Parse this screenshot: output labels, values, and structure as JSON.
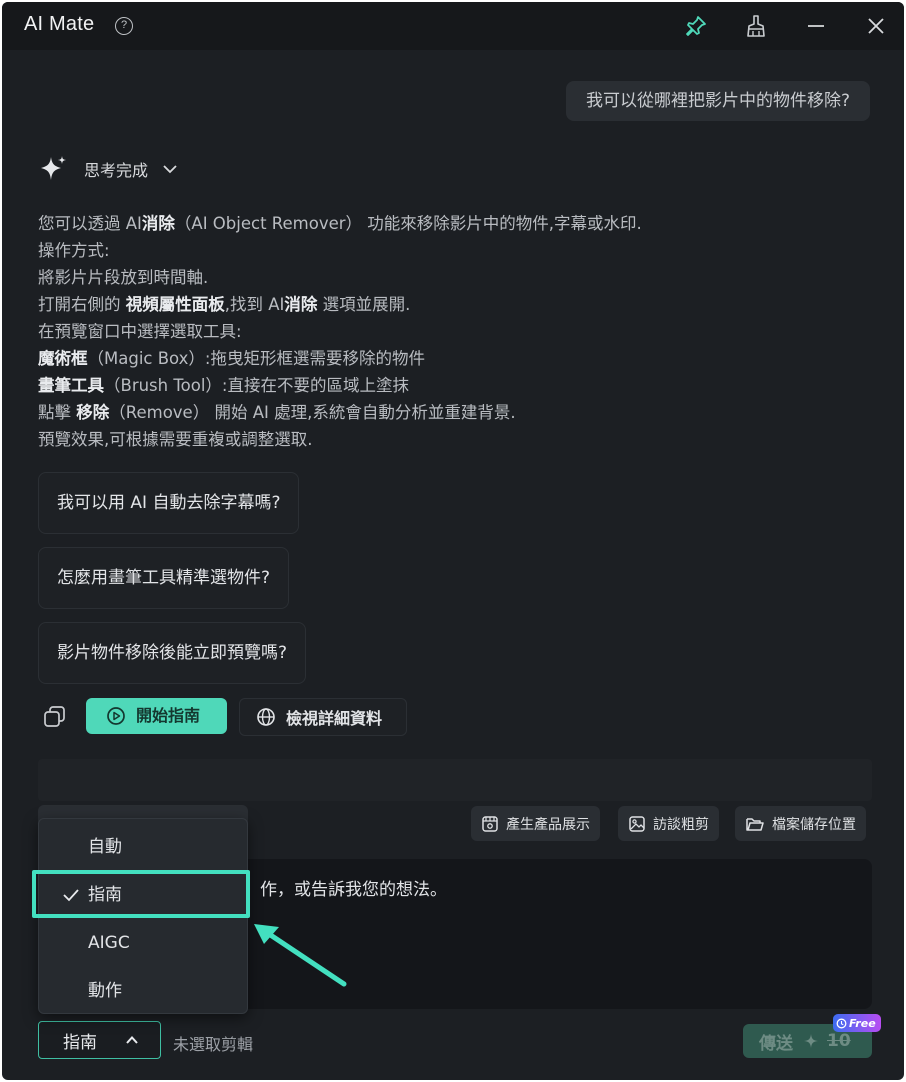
{
  "window": {
    "title": "AI Mate"
  },
  "titlebar": {
    "help": "?",
    "icons": [
      "help-icon",
      "pin-icon",
      "broom-icon",
      "minimize-icon",
      "close-icon"
    ]
  },
  "chat": {
    "user_message": "我可以從哪裡把影片中的物件移除?",
    "thinking_label": "思考完成",
    "answer_lines": [
      [
        {
          "t": "您可以透過 AI",
          "b": false
        },
        {
          "t": "消除",
          "b": true
        },
        {
          "t": "（AI Object Remover） 功能來移除影片中的物件,字幕或水印.",
          "b": false
        }
      ],
      [
        {
          "t": "操作方式:",
          "b": false
        }
      ],
      [
        {
          "t": "將影片片段放到時間軸.",
          "b": false
        }
      ],
      [
        {
          "t": "打開右側的 ",
          "b": false
        },
        {
          "t": "視頻屬性面板",
          "b": true
        },
        {
          "t": ",找到 AI",
          "b": false
        },
        {
          "t": "消除",
          "b": true
        },
        {
          "t": " 選項並展開.",
          "b": false
        }
      ],
      [
        {
          "t": "在預覽窗口中選擇選取工具:",
          "b": false
        }
      ],
      [
        {
          "t": "魔術框",
          "b": true
        },
        {
          "t": "（Magic Box）:拖曳矩形框選需要移除的物件",
          "b": false
        }
      ],
      [
        {
          "t": "畫筆工具",
          "b": true
        },
        {
          "t": "（Brush Tool）:直接在不要的區域上塗抹",
          "b": false
        }
      ],
      [
        {
          "t": "點擊 ",
          "b": false
        },
        {
          "t": "移除",
          "b": true
        },
        {
          "t": "（Remove） 開始 AI 處理,系統會自動分析並重建背景.",
          "b": false
        }
      ],
      [
        {
          "t": "預覽效果,可根據需要重複或調整選取.",
          "b": false
        }
      ]
    ],
    "suggestions": [
      "我可以用 AI 自動去除字幕嗎?",
      "怎麼用畫筆工具精準選物件?",
      "影片物件移除後能立即預覽嗎?"
    ],
    "start_guide_label": "開始指南",
    "view_details_label": "檢視詳細資料"
  },
  "composer": {
    "chips": [
      "產生產品展示",
      "訪談粗剪",
      "檔案儲存位置"
    ],
    "placeholder_visible": "作，或告訴我您的想法。",
    "mode_selected": "指南",
    "no_clip_label": "未選取剪輯",
    "send_label": "傳送",
    "send_cost": "10",
    "free_badge": "Free"
  },
  "mode_dropdown": {
    "options": [
      "自動",
      "指南",
      "AIGC",
      "動作"
    ],
    "selected_index": 1
  },
  "colors": {
    "accent": "#4fd8b9",
    "highlight": "#43e0c0",
    "bg": "#1c1f23"
  }
}
